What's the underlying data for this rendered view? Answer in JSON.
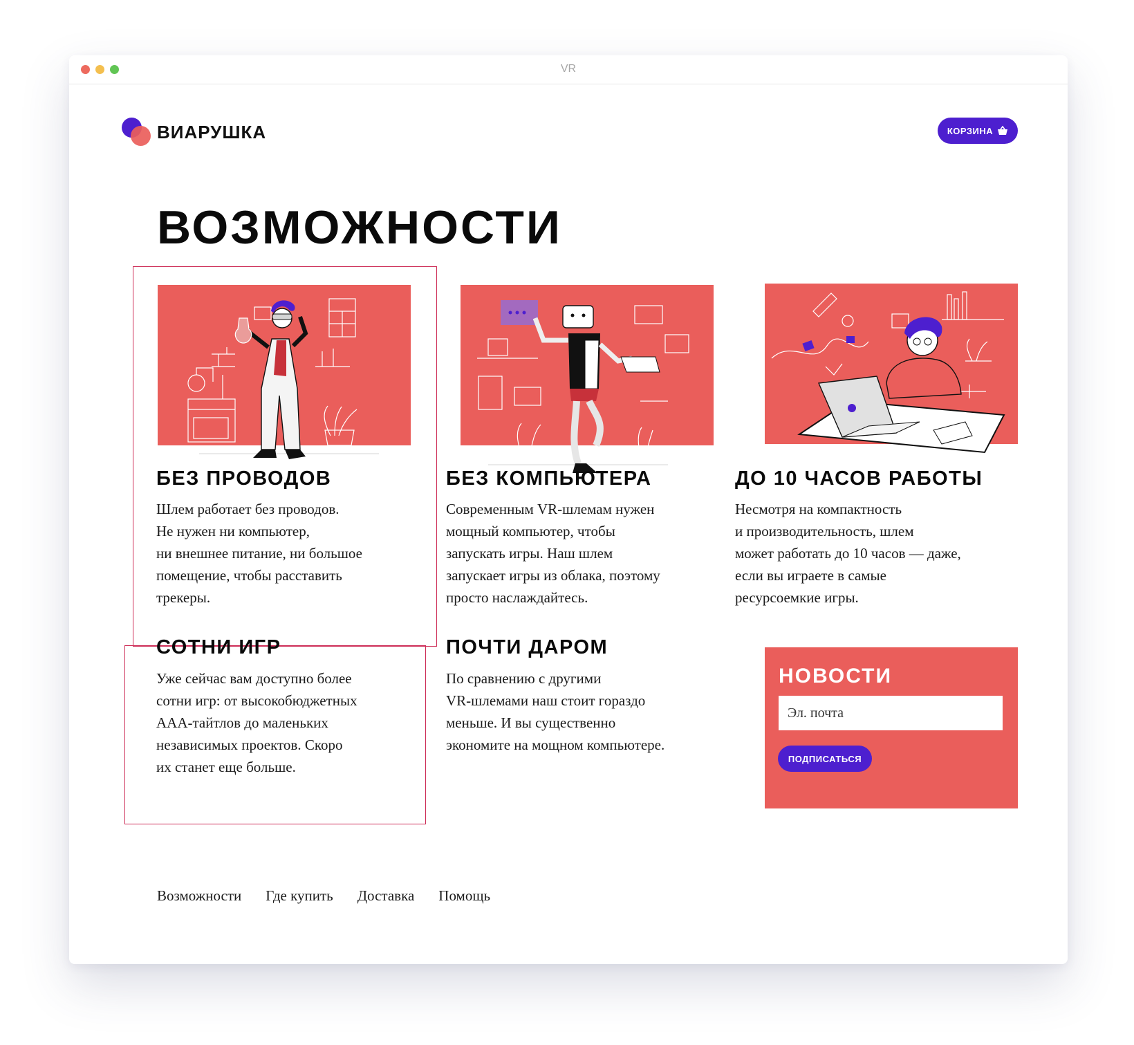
{
  "window": {
    "title": "VR"
  },
  "header": {
    "logo_text": "ВИАРУШКА",
    "cart_label": "КОРЗИНА",
    "cart_icon": "basket-icon"
  },
  "page_title": "ВОЗМОЖНОСТИ",
  "features": [
    {
      "title": "БЕЗ ПРОВОДОВ",
      "text": "Шлем работает без проводов.\nНе нужен ни компьютер,\nни внешнее питание, ни большое\nпомещение, чтобы расставить\nтрекеры."
    },
    {
      "title": "БЕЗ КОМПЬЮТЕРА",
      "text": "Современным VR-шлемам нужен\nмощный компьютер, чтобы\nзапускать игры. Наш шлем\nзапускает игры из облака, поэтому\nпросто наслаждайтесь."
    },
    {
      "title": "ДО 10 ЧАСОВ РАБОТЫ",
      "text": "Несмотря на компактность\nи производительность, шлем\nможет работать до 10 часов — даже,\nесли вы играете в самые\nресурсоемкие игры."
    },
    {
      "title": "СОТНИ ИГР",
      "text": "Уже сейчас вам доступно более\nсотни игр: от высокобюджетных\nААА-тайтлов до маленьких\nнезависимых проектов. Скоро\nих станет еще больше."
    },
    {
      "title": "ПОЧТИ ДАРОМ",
      "text": "По сравнению с другими\nVR-шлемами наш стоит гораздо\nменьше. И вы существенно\nэкономите на мощном компьютере."
    }
  ],
  "news": {
    "title": "НОВОСТИ",
    "email_placeholder": "Эл. почта",
    "subscribe_label": "ПОДПИСАТЬСЯ"
  },
  "footer_nav": [
    "Возможности",
    "Где купить",
    "Доставка",
    "Помощь"
  ],
  "colors": {
    "accent_purple": "#4d1fcf",
    "coral": "#ea5e5b",
    "highlight_border": "#cd2c56"
  }
}
